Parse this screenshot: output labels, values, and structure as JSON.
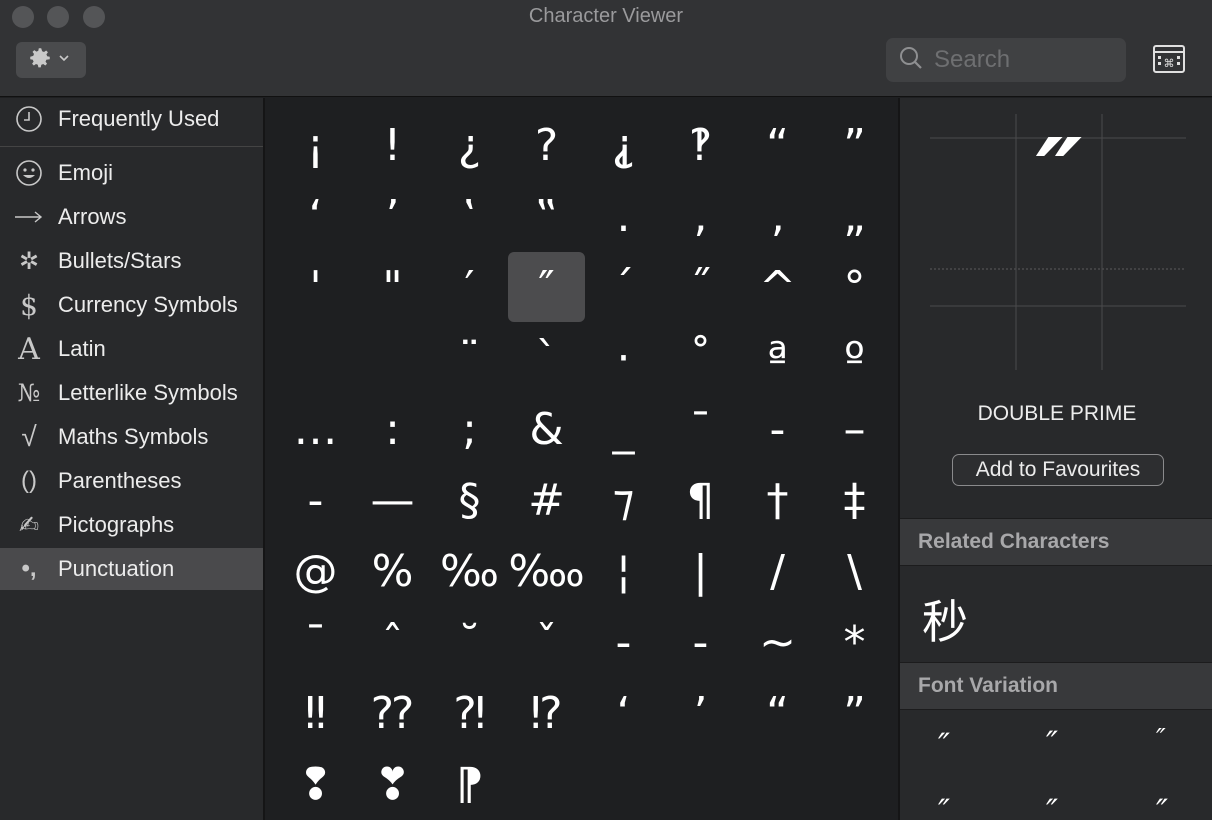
{
  "window": {
    "title": "Character Viewer"
  },
  "toolbar": {
    "gear_icon": "gear-icon",
    "search_placeholder": "Search",
    "keyboard_icon": "keyboard-viewer-icon"
  },
  "sidebar": {
    "items": [
      {
        "label": "Frequently Used",
        "icon": "🕘"
      },
      {
        "label": "Emoji",
        "icon": "☺"
      },
      {
        "label": "Arrows",
        "icon": "⟶"
      },
      {
        "label": "Bullets/Stars",
        "icon": "✲"
      },
      {
        "label": "Currency Symbols",
        "icon": "$"
      },
      {
        "label": "Latin",
        "icon": "A"
      },
      {
        "label": "Letterlike Symbols",
        "icon": "№"
      },
      {
        "label": "Maths Symbols",
        "icon": "√"
      },
      {
        "label": "Parentheses",
        "icon": "()"
      },
      {
        "label": "Pictographs",
        "icon": "✍"
      },
      {
        "label": "Punctuation",
        "icon": "•,",
        "selected": true
      }
    ]
  },
  "grid": {
    "rows": [
      [
        "¡",
        "!",
        "¿",
        "?",
        "⸘",
        "‽",
        "“",
        "”"
      ],
      [
        "‘",
        "’",
        "‛",
        "‟",
        ".",
        ",",
        "‚",
        "„"
      ],
      [
        "'",
        "\"",
        "′",
        "″",
        "´",
        "˝",
        "^",
        "°"
      ],
      [
        "",
        "",
        "¨",
        "`",
        "·",
        "˚",
        "ª",
        "º"
      ],
      [
        "…",
        ":",
        ";",
        "&",
        "_",
        "¯",
        "-",
        "–"
      ],
      [
        "-",
        "—",
        "§",
        "#",
        "⁊",
        "¶",
        "†",
        "‡"
      ],
      [
        "@",
        "%",
        "‰",
        "‱",
        "¦",
        "|",
        "/",
        "\\"
      ],
      [
        "ˉ",
        "ˆ",
        "˘",
        "ˇ",
        "-",
        "-",
        "~",
        "*"
      ],
      [
        "‼",
        "⁇",
        "⁈",
        "⁉",
        "‘",
        "’",
        "“",
        "”"
      ],
      [
        "❢",
        "❣",
        "⁋",
        "",
        "",
        "",
        "",
        ""
      ]
    ],
    "selected": {
      "row": 2,
      "col": 3
    }
  },
  "detail": {
    "glyph": "″",
    "name": "DOUBLE PRIME",
    "favourite_label": "Add to Favourites",
    "related_header": "Related Characters",
    "related": [
      "秒"
    ],
    "variation_header": "Font Variation",
    "variations": [
      "″",
      "″",
      "″",
      "″",
      "″",
      "″"
    ]
  },
  "colors": {
    "background": "#1e1f21",
    "panel": "#28292b",
    "selection": "#4c4c4e",
    "text": "#ffffff"
  }
}
